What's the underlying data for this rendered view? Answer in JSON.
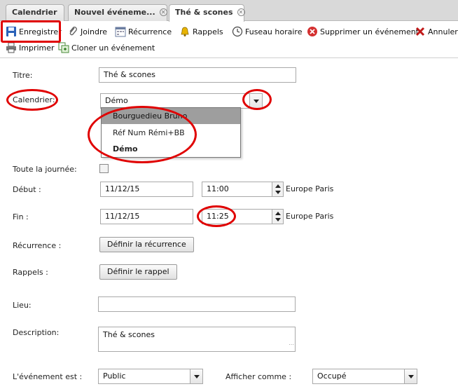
{
  "tabs": [
    {
      "label": "Calendrier"
    },
    {
      "label": "Nouvel événeme..."
    },
    {
      "label": "Thé & scones"
    }
  ],
  "toolbar": {
    "save": "Enregistrer",
    "attach": "Joindre",
    "recurrence": "Récurrence",
    "reminders": "Rappels",
    "timezone": "Fuseau horaire",
    "delete": "Supprimer un événement",
    "cancel": "Annuler",
    "print": "Imprimer",
    "clone": "Cloner un événement"
  },
  "form": {
    "title_label": "Titre:",
    "title_value": "Thé & scones",
    "calendar_label": "Calendrier:",
    "calendar_value": "Démo",
    "calendar_options": [
      "Bourguedieu Bruno",
      "Réf Num Rémi+BB",
      "Démo"
    ],
    "allday_label": "Toute la journée:",
    "start_label": "Début :",
    "start_date": "11/12/15",
    "start_time": "11:00",
    "start_tz": "Europe Paris",
    "end_label": "Fin :",
    "end_date": "11/12/15",
    "end_time": "11:25",
    "end_tz": "Europe Paris",
    "recurrence_label": "Récurrence :",
    "recurrence_button": "Définir la récurrence",
    "reminders_label": "Rappels :",
    "reminders_button": "Définir le rappel",
    "location_label": "Lieu:",
    "location_value": "",
    "description_label": "Description:",
    "description_value": "Thé & scones",
    "visibility_label": "L'événement est :",
    "visibility_value": "Public",
    "showas_label": "Afficher comme :",
    "showas_value": "Occupé"
  },
  "colors": {
    "annotation": "#e00000",
    "dropdown_selected": "#9e9e9e"
  }
}
